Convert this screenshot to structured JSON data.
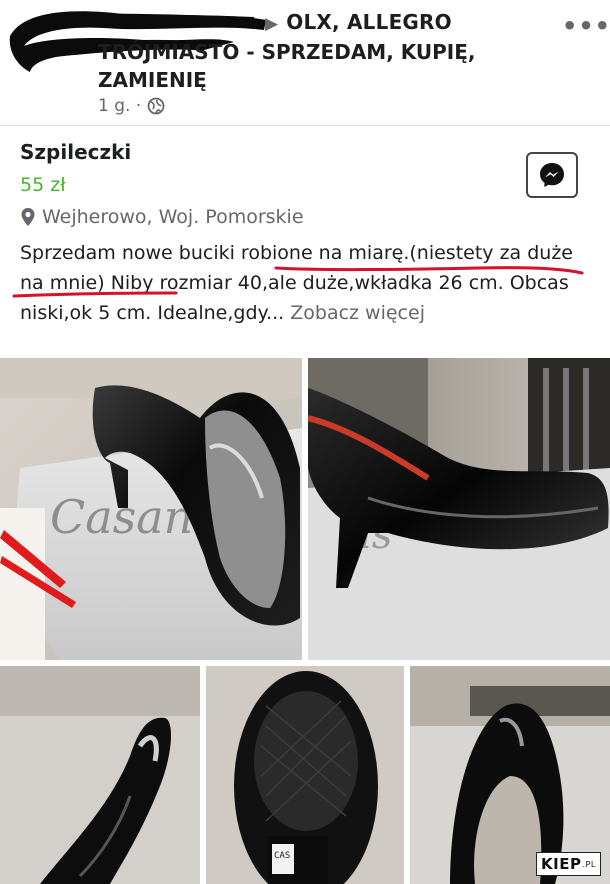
{
  "header": {
    "group_line": "OLX, ALLEGRO",
    "group_title": "TRÓJMIASTO - SPRZEDAM, KUPIĘ, ZAMIENIĘ",
    "time": "1 g. ·",
    "more_label": "•••"
  },
  "listing": {
    "title": "Szpileczki",
    "price": "55 zł",
    "location": "Wejherowo, Woj. Pomorskie",
    "description": "Sprzedam nowe buciki robione na miarę.(niestety za duże na mnie) Niby rozmiar 40,ale duże,wkładka 26 cm. Obcas niski,ok 5 cm. Idealne,gdy...",
    "see_more": "Zobacz więcej"
  },
  "photos": [
    {
      "alt": "shoe-on-box-photo",
      "box_text": "Casan"
    },
    {
      "alt": "shoe-side-photo",
      "box_text": "as"
    },
    {
      "alt": "shoe-heel-photo"
    },
    {
      "alt": "shoe-sole-photo",
      "label_text": "CAS"
    },
    {
      "alt": "shoe-front-photo"
    }
  ],
  "watermark": {
    "main": "KIEP",
    "suffix": ".PL"
  },
  "colors": {
    "price": "#42b72a",
    "underline": "#d6122a",
    "muted": "#65676b"
  },
  "icons": [
    "messenger-icon",
    "globe-icon",
    "location-pin-icon",
    "more-options-icon",
    "caret-right-icon"
  ]
}
